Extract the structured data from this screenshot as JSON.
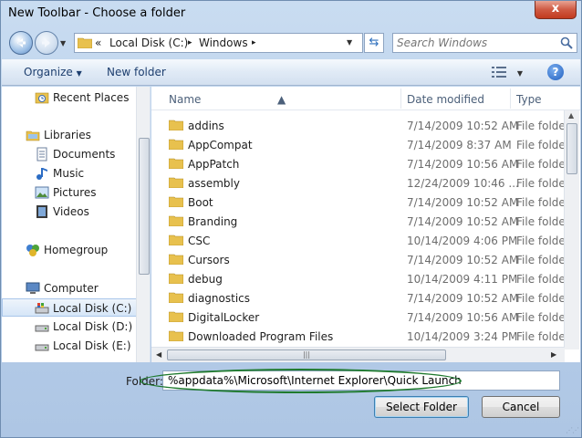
{
  "window": {
    "title": "New Toolbar - Choose a folder",
    "close_glyph": "x"
  },
  "address_bar": {
    "overflow": "«",
    "segments": [
      "Local Disk (C:)",
      "Windows"
    ],
    "separator": "▸"
  },
  "search": {
    "placeholder": "Search Windows"
  },
  "toolbar": {
    "organize": "Organize",
    "new_folder": "New folder"
  },
  "nav_pane": {
    "items": [
      {
        "label": "Recent Places",
        "icon": "recent-places-icon"
      },
      {
        "label": "Libraries",
        "icon": "libraries-icon"
      },
      {
        "label": "Documents",
        "icon": "documents-icon"
      },
      {
        "label": "Music",
        "icon": "music-icon"
      },
      {
        "label": "Pictures",
        "icon": "pictures-icon"
      },
      {
        "label": "Videos",
        "icon": "videos-icon"
      },
      {
        "label": "Homegroup",
        "icon": "homegroup-icon"
      },
      {
        "label": "Computer",
        "icon": "computer-icon"
      },
      {
        "label": "Local Disk (C:)",
        "icon": "drive-icon",
        "selected": true
      },
      {
        "label": "Local Disk (D:)",
        "icon": "drive-icon"
      },
      {
        "label": "Local Disk (E:)",
        "icon": "drive-icon"
      }
    ]
  },
  "columns": {
    "name": "Name",
    "date": "Date modified",
    "type": "Type"
  },
  "files": [
    {
      "name": "addins",
      "date": "7/14/2009 10:52 AM",
      "type": "File folde"
    },
    {
      "name": "AppCompat",
      "date": "7/14/2009 8:37 AM",
      "type": "File folde"
    },
    {
      "name": "AppPatch",
      "date": "7/14/2009 10:56 AM",
      "type": "File folde"
    },
    {
      "name": "assembly",
      "date": "12/24/2009 10:46 ...",
      "type": "File folde"
    },
    {
      "name": "Boot",
      "date": "7/14/2009 10:52 AM",
      "type": "File folde"
    },
    {
      "name": "Branding",
      "date": "7/14/2009 10:52 AM",
      "type": "File folde"
    },
    {
      "name": "CSC",
      "date": "10/14/2009 4:06 PM",
      "type": "File folde"
    },
    {
      "name": "Cursors",
      "date": "7/14/2009 10:52 AM",
      "type": "File folde"
    },
    {
      "name": "debug",
      "date": "10/14/2009 4:11 PM",
      "type": "File folde"
    },
    {
      "name": "diagnostics",
      "date": "7/14/2009 10:52 AM",
      "type": "File folde"
    },
    {
      "name": "DigitalLocker",
      "date": "7/14/2009 10:56 AM",
      "type": "File folde"
    },
    {
      "name": "Downloaded Program Files",
      "date": "10/14/2009 3:24 PM",
      "type": "File folde"
    }
  ],
  "folder_field": {
    "label": "Folder:",
    "value": "%appdata%\\Microsoft\\Internet Explorer\\Quick Launch"
  },
  "buttons": {
    "select": "Select Folder",
    "cancel": "Cancel"
  },
  "colors": {
    "highlight_ellipse": "#1f7a2e",
    "folder": "#e8c14e"
  }
}
